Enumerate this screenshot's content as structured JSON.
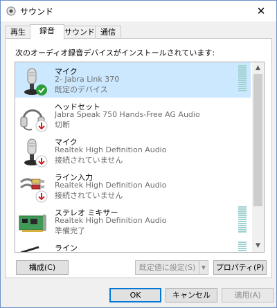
{
  "window": {
    "title": "サウンド",
    "close_glyph": "✕"
  },
  "tabs": [
    {
      "label": "再生"
    },
    {
      "label": "録音"
    },
    {
      "label": "サウンド"
    },
    {
      "label": "通信"
    }
  ],
  "panel": {
    "label": "次のオーディオ録音デバイスがインストールされています:"
  },
  "devices": [
    {
      "name": "マイク",
      "desc": "2- Jabra Link 370",
      "status": "既定のデバイス",
      "icon": "microphone-icon",
      "badge": "green-check-badge",
      "selected": true,
      "level": 0
    },
    {
      "name": "ヘッドセット",
      "desc": "Jabra Speak 750 Hands-Free AG Audio",
      "status": "切断",
      "icon": "headset-icon",
      "badge": "red-down-arrow-badge"
    },
    {
      "name": "マイク",
      "desc": "Realtek High Definition Audio",
      "status": "接続されていません",
      "icon": "microphone-icon",
      "badge": "red-down-arrow-badge"
    },
    {
      "name": "ライン入力",
      "desc": "Realtek High Definition Audio",
      "status": "接続されていません",
      "icon": "line-in-cable-icon",
      "badge": "red-down-arrow-badge"
    },
    {
      "name": "ステレオ ミキサー",
      "desc": "Realtek High Definition Audio",
      "status": "準備完了",
      "icon": "sound-card-icon",
      "badge": "",
      "level": 0
    },
    {
      "name": "ライン",
      "desc": "",
      "status": "",
      "icon": "line-icon",
      "badge": ""
    }
  ],
  "buttons": {
    "configure": "構成(C)",
    "set_default": "既定値に設定(S)",
    "properties": "プロパティ(P)",
    "ok": "OK",
    "cancel": "キャンセル",
    "apply": "適用(A)"
  },
  "colors": {
    "selected_row": "#cce8ff",
    "accent": "#0078d7",
    "check_green": "#2e9e3b",
    "arrow_red": "#d42020"
  }
}
